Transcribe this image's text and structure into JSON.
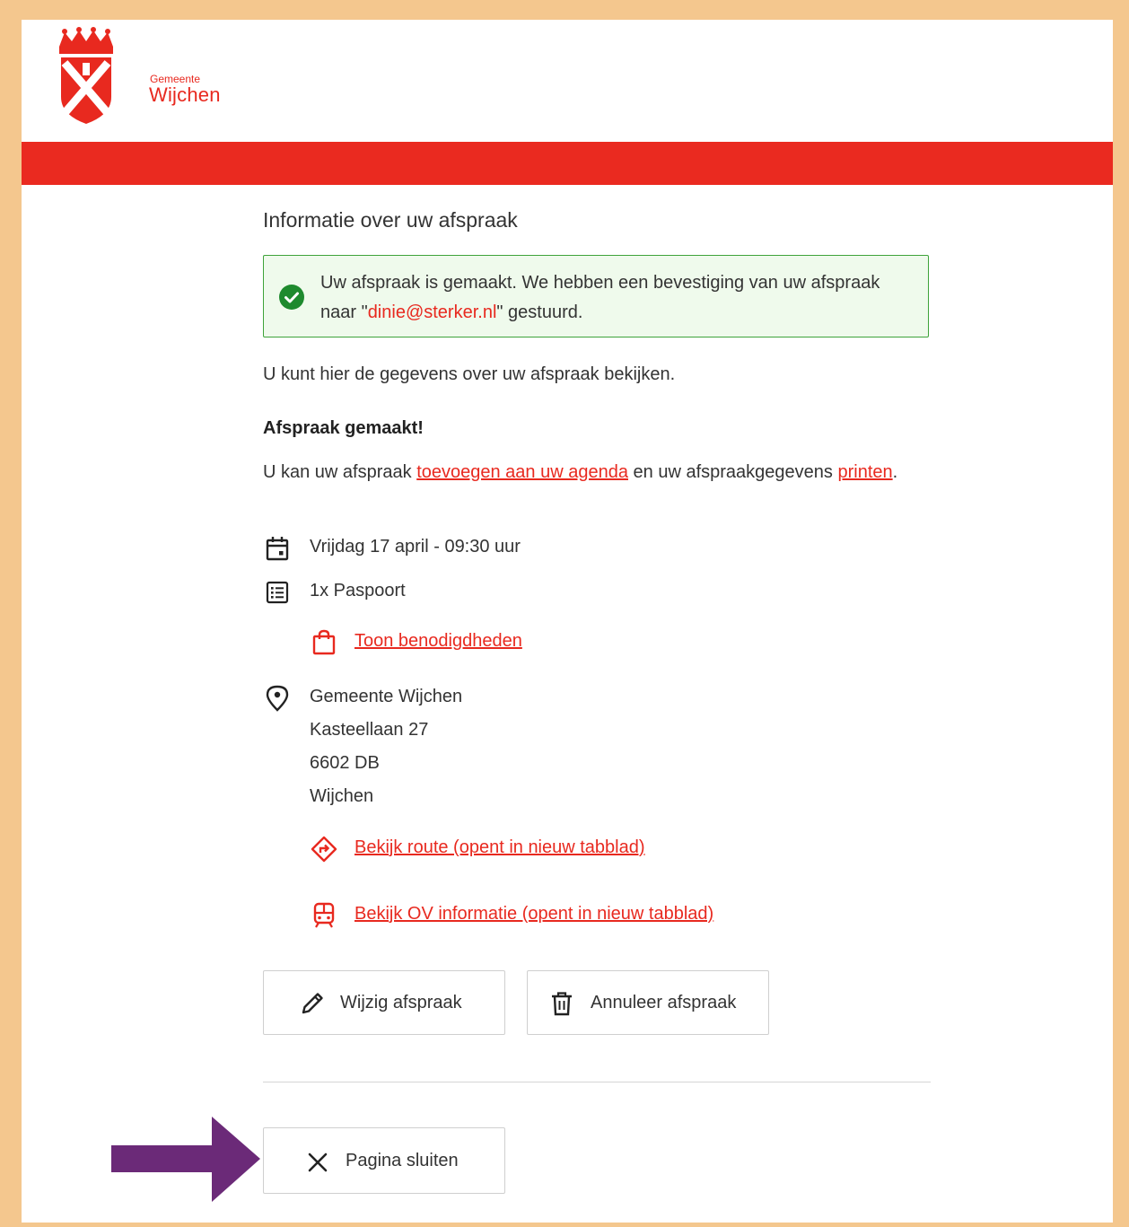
{
  "logo": {
    "sub": "Gemeente",
    "main": "Wijchen"
  },
  "page_title": "Informatie over uw afspraak",
  "success": {
    "text_before": "Uw afspraak is gemaakt. We hebben een bevestiging van uw afspraak naar \"",
    "email": "dinie@sterker.nl",
    "text_after": "\" gestuurd."
  },
  "intro": "U kunt hier de gegevens over uw afspraak bekijken.",
  "made_heading": "Afspraak gemaakt!",
  "info": {
    "text_1": "U kan uw afspraak ",
    "link_agenda": "toevoegen aan uw agenda",
    "text_2": " en uw afspraakgegevens ",
    "link_print": "printen",
    "text_3": "."
  },
  "appointment": {
    "date": "Vrijdag 17 april - 09:30 uur",
    "product": "1x Paspoort",
    "requirements_link": "Toon benodigdheden",
    "location": {
      "name": "Gemeente Wijchen",
      "street": "Kasteellaan 27",
      "postcode": "6602 DB",
      "city": "Wijchen"
    },
    "route_link": "Bekijk route (opent in nieuw tabblad)",
    "ov_link": "Bekijk OV informatie (opent in nieuw tabblad)"
  },
  "buttons": {
    "edit": "Wijzig afspraak",
    "cancel": "Annuleer afspraak",
    "close": "Pagina sluiten"
  },
  "colors": {
    "brand_red": "#ea2a20",
    "link_red": "#e8291f",
    "success_green": "#3ea33a",
    "frame_border": "#f4c78e",
    "arrow_purple": "#6b2a78"
  },
  "icons": [
    "calendar-icon",
    "list-icon",
    "shopping-bag-icon",
    "location-pin-icon",
    "route-icon",
    "train-icon",
    "pencil-icon",
    "trash-icon",
    "close-icon",
    "check-circle-icon"
  ]
}
